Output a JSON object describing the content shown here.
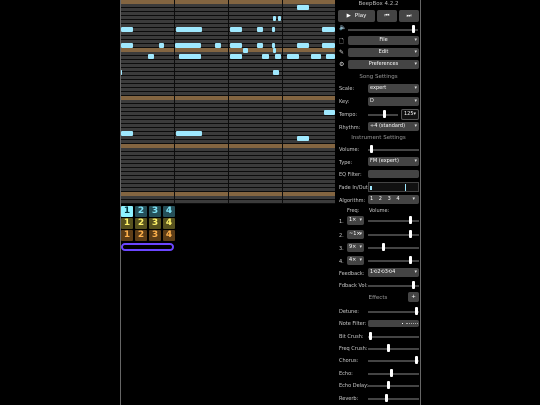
{
  "app": {
    "title": "BeepBox 4.2.2"
  },
  "transport": {
    "play_label": "Play"
  },
  "menus": {
    "file": "File",
    "edit": "Edit",
    "preferences": "Preferences"
  },
  "song_settings": {
    "header": "Song Settings",
    "scale_label": "Scale:",
    "scale_value": "expert",
    "key_label": "Key:",
    "key_value": "D",
    "tempo_label": "Tempo:",
    "tempo_value": "125",
    "rhythm_label": "Rhythm:",
    "rhythm_value": "÷4 (standard)"
  },
  "instrument_settings": {
    "header": "Instrument Settings",
    "volume_label": "Volume:",
    "type_label": "Type:",
    "type_value": "FM (expert)",
    "eq_label": "EQ Filter:",
    "fade_label": "Fade In/Out:",
    "algorithm_label": "Algorithm:",
    "algorithm_options": [
      "1",
      "2",
      "3",
      "4"
    ],
    "freq_header": "Freq:",
    "vol_header": "Volume:",
    "operators": [
      {
        "num": "1.",
        "freq": "1×"
      },
      {
        "num": "2.",
        "freq": "~1×"
      },
      {
        "num": "3.",
        "freq": "9×"
      },
      {
        "num": "4.",
        "freq": "4×"
      }
    ],
    "feedback_label": "Feedback:",
    "feedback_value": "1⟲2⟲3⟲4",
    "fdback_vol_label": "Fdback Vol:"
  },
  "effects": {
    "header": "Effects",
    "add_label": "+",
    "detune_label": "Detune:",
    "note_filter_label": "Note Filter:",
    "bit_crush_label": "Bit Crush:",
    "freq_crush_label": "Freq Crush:",
    "chorus_label": "Chorus:",
    "echo_label": "Echo:",
    "echo_delay_label": "Echo Delay:",
    "reverb_label": "Reverb:"
  },
  "tracks": {
    "rows": [
      [
        "1",
        "2",
        "3",
        "4"
      ],
      [
        "1",
        "2",
        "3",
        "4"
      ],
      [
        "1",
        "2",
        "3",
        "4"
      ]
    ]
  },
  "colors": {
    "note": "#9fe9ff",
    "octave_row": "#836541",
    "pitch_row": "#3b3b3b",
    "control": "#444444",
    "loop": "#6b46ff"
  },
  "settings_levels": {
    "master_volume": 0.95,
    "tempo_position": 0.55,
    "instrument_volume": 0.05,
    "operator_volumes": [
      0.85,
      0.85,
      0.3,
      0.85
    ],
    "fdback_vol": 0.92,
    "detune": 0.98,
    "bit_crush": 0.02,
    "freq_crush": 0.4,
    "chorus": 0.98,
    "echo": 0.45,
    "echo_delay": 0.4,
    "reverb": 0.35
  }
}
